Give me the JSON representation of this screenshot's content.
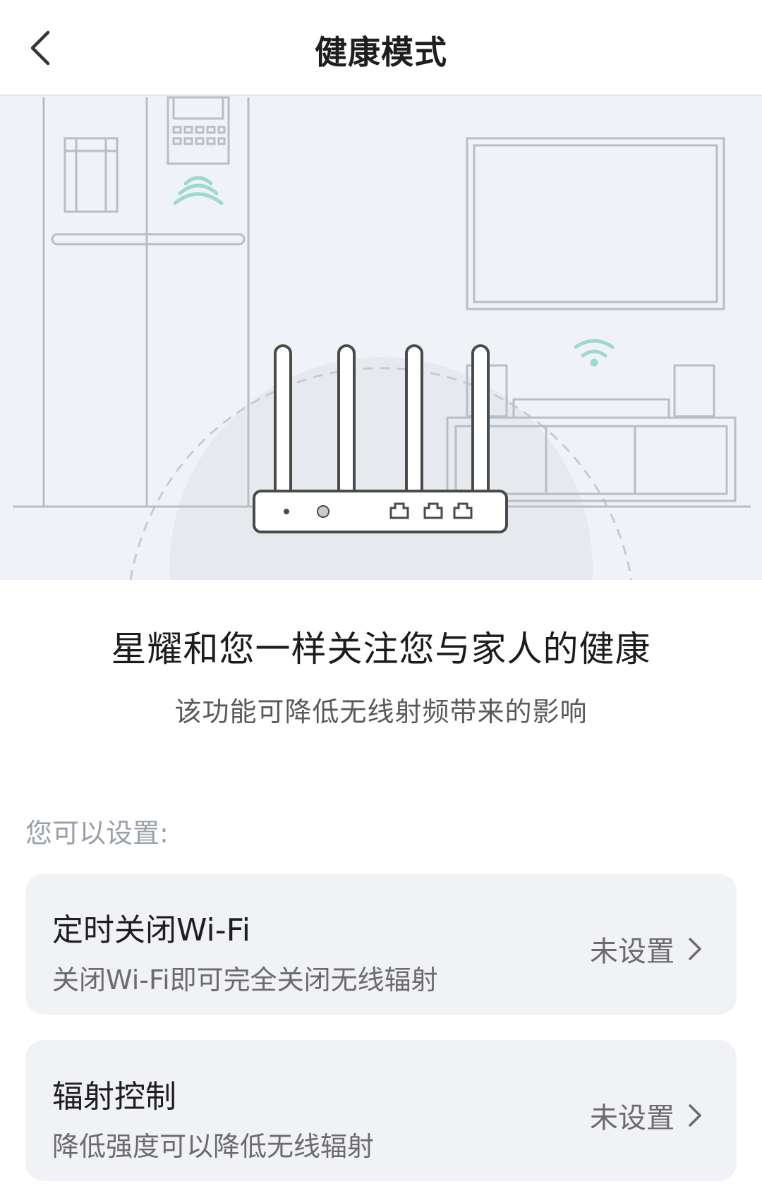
{
  "header": {
    "title": "健康模式",
    "back_icon": "chevron-left-icon"
  },
  "hero": {
    "headline": "星耀和您一样关注您与家人的健康",
    "subline": "该功能可降低无线射频带来的影响",
    "accent_color": "#9fd8cd",
    "line_color": "#b9bec4"
  },
  "settings": {
    "label": "您可以设置:",
    "items": [
      {
        "title": "定时关闭Wi-Fi",
        "description": "关闭Wi-Fi即可完全关闭无线辐射",
        "status": "未设置",
        "icon": "chevron-right-icon"
      },
      {
        "title": "辐射控制",
        "description": "降低强度可以降低无线辐射",
        "status": "未设置",
        "icon": "chevron-right-icon"
      }
    ]
  }
}
